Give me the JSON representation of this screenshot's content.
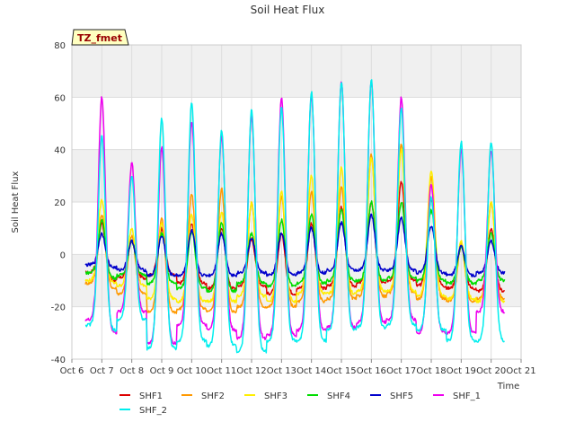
{
  "chart_data": {
    "type": "line",
    "title": "Soil Heat Flux",
    "xlabel": "Time",
    "ylabel": "Soil Heat Flux",
    "annotation": "TZ_fmet",
    "ylim": [
      -40,
      80
    ],
    "yticks": [
      -40,
      -20,
      0,
      20,
      40,
      60,
      80
    ],
    "xlim": [
      6,
      21
    ],
    "xticks": [
      {
        "v": 6,
        "label": "Oct 6"
      },
      {
        "v": 7,
        "label": "Oct 7"
      },
      {
        "v": 8,
        "label": "Oct 8"
      },
      {
        "v": 9,
        "label": "Oct 9"
      },
      {
        "v": 10,
        "label": "Oct 10"
      },
      {
        "v": 11,
        "label": "Oct 11"
      },
      {
        "v": 12,
        "label": "Oct 12"
      },
      {
        "v": 13,
        "label": "Oct 13"
      },
      {
        "v": 14,
        "label": "Oct 14"
      },
      {
        "v": 15,
        "label": "Oct 15"
      },
      {
        "v": 16,
        "label": "Oct 16"
      },
      {
        "v": 17,
        "label": "Oct 17"
      },
      {
        "v": 18,
        "label": "Oct 18"
      },
      {
        "v": 19,
        "label": "Oct 19"
      },
      {
        "v": 20,
        "label": "Oct 20"
      },
      {
        "v": 21,
        "label": "Oct 21"
      }
    ],
    "grid": true,
    "bands": "alternating grey horizontal bands",
    "legend_position": "bottom",
    "days": [
      6.5,
      7,
      8,
      9,
      10,
      11,
      12,
      13,
      14,
      15,
      16,
      17,
      18,
      19,
      20
    ],
    "series": [
      {
        "name": "SHF1",
        "color": "#dd0000",
        "peaks": [
          17,
          12,
          5,
          10,
          12,
          10,
          6,
          8,
          12,
          18,
          20,
          28,
          21,
          3,
          10
        ],
        "troughs": [
          -7,
          -10,
          -9,
          -8,
          -11,
          -13,
          -12,
          -15,
          -13,
          -12,
          -11,
          -10,
          -12,
          -13,
          -14
        ]
      },
      {
        "name": "SHF2",
        "color": "#ff9900",
        "peaks": [
          19,
          15,
          7,
          14,
          23,
          25,
          20,
          22,
          24,
          26,
          38,
          42,
          30,
          4,
          20
        ],
        "troughs": [
          -11,
          -13,
          -15,
          -22,
          -21,
          -22,
          -20,
          -20,
          -18,
          -17,
          -16,
          -15,
          -17,
          -18,
          -17
        ]
      },
      {
        "name": "SHF3",
        "color": "#ffee00",
        "peaks": [
          15,
          21,
          10,
          12,
          15,
          16,
          20,
          24,
          30,
          33,
          37,
          40,
          32,
          5,
          20
        ],
        "troughs": [
          -10,
          -11,
          -12,
          -17,
          -18,
          -18,
          -16,
          -18,
          -15,
          -15,
          -14,
          -14,
          -16,
          -17,
          -18
        ]
      },
      {
        "name": "SHF4",
        "color": "#00dd00",
        "peaks": [
          11,
          13,
          5,
          8,
          9,
          12,
          8,
          13,
          15,
          17,
          20,
          20,
          17,
          3,
          8
        ],
        "troughs": [
          -7,
          -9,
          -8,
          -11,
          -13,
          -14,
          -11,
          -12,
          -11,
          -10,
          -10,
          -9,
          -10,
          -11,
          -10
        ]
      },
      {
        "name": "SHF5",
        "color": "#0000cc",
        "peaks": [
          7,
          8,
          5,
          7,
          9,
          8,
          6,
          8,
          10,
          12,
          15,
          14,
          11,
          3,
          5
        ],
        "troughs": [
          -4,
          -5,
          -6,
          -8,
          -8,
          -8,
          -7,
          -8,
          -7,
          -6,
          -6,
          -6,
          -7,
          -8,
          -7
        ]
      },
      {
        "name": "SHF_1",
        "color": "#ee00ee",
        "peaks": [
          44,
          60,
          35,
          41,
          51,
          45,
          53,
          60,
          61,
          66,
          66,
          60,
          27,
          40,
          40
        ],
        "troughs": [
          -25,
          -30,
          -22,
          -34,
          -27,
          -29,
          -32,
          -31,
          -29,
          -28,
          -26,
          -25,
          -30,
          -30,
          -22
        ]
      },
      {
        "name": "SHF_2",
        "color": "#00eeee",
        "peaks": [
          32,
          45,
          30,
          52,
          58,
          47,
          55,
          56,
          62,
          66,
          67,
          56,
          22,
          43,
          43
        ],
        "troughs": [
          -27,
          -29,
          -25,
          -36,
          -33,
          -35,
          -37,
          -33,
          -33,
          -29,
          -28,
          -27,
          -29,
          -33,
          -33
        ]
      }
    ]
  }
}
